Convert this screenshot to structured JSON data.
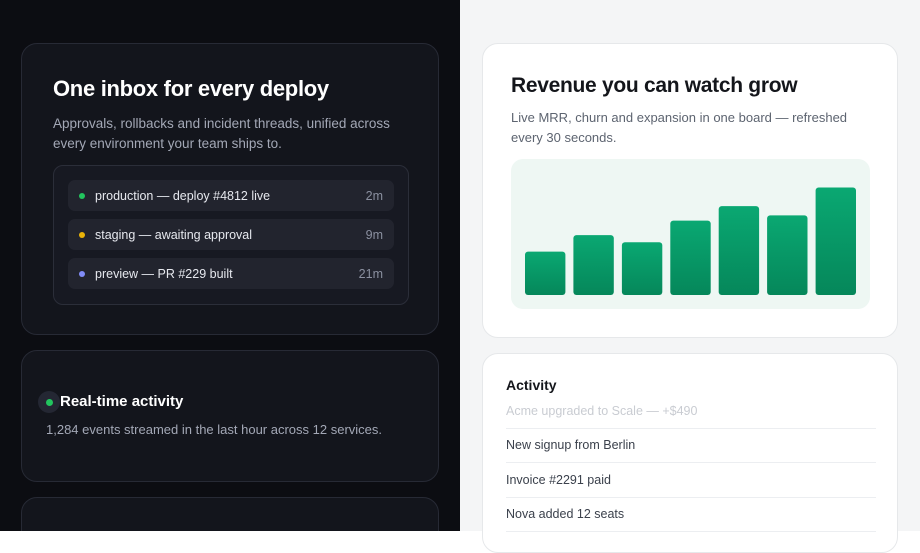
{
  "hero": {
    "title": "One inbox for every deploy",
    "subtitle": "Approvals, rollbacks and incident threads, unified across every environment your team ships to.",
    "deploys": [
      {
        "label": "production — deploy #4812 live",
        "time": "2m",
        "status_color": "#22c55e"
      },
      {
        "label": "staging — awaiting approval",
        "time": "9m",
        "status_color": "#eab308"
      },
      {
        "label": "preview — PR #229 built",
        "time": "21m",
        "status_color": "#818cf8"
      }
    ]
  },
  "realtime": {
    "title": "Real-time activity",
    "subtitle": "1,284 events streamed in the last hour across 12 services."
  },
  "revenue": {
    "title": "Revenue you can watch grow",
    "subtitle": "Live MRR, churn and expansion in one board — refreshed every 30 seconds."
  },
  "chart_data": {
    "type": "bar",
    "values": [
      42,
      58,
      51,
      72,
      86,
      77,
      104
    ],
    "ylim": [
      0,
      120
    ],
    "grid": false,
    "color_top": "#0aa872",
    "color_bottom": "#05875a"
  },
  "activity": {
    "title": "Activity",
    "items": [
      {
        "text": "Acme upgraded to Scale — +$490"
      },
      {
        "text": "New signup from Berlin"
      },
      {
        "text": "Invoice #2291 paid"
      },
      {
        "text": "Nova added 12 seats"
      }
    ]
  }
}
